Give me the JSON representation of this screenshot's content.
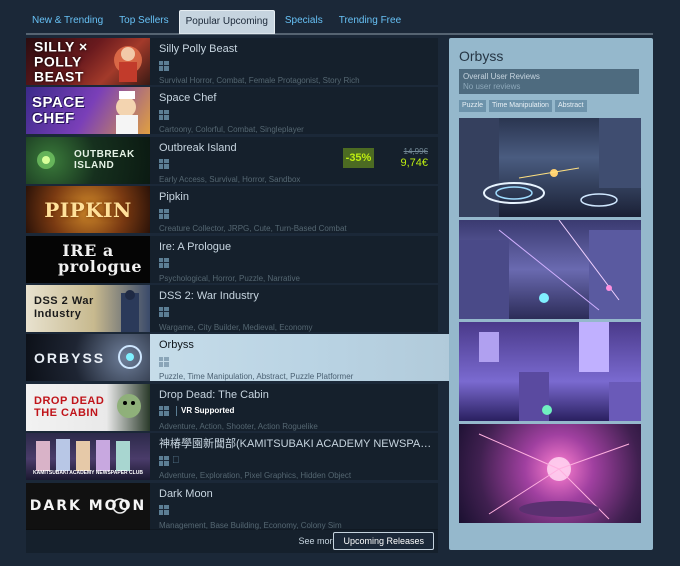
{
  "tabs": [
    {
      "label": "New & Trending",
      "active": false
    },
    {
      "label": "Top Sellers",
      "active": false
    },
    {
      "label": "Popular Upcoming",
      "active": true
    },
    {
      "label": "Specials",
      "active": false
    },
    {
      "label": "Trending Free",
      "active": false
    }
  ],
  "games": [
    {
      "name": "Silly Polly Beast",
      "tags": "Survival Horror, Combat, Female Protagonist, Story Rich",
      "capsule": "SILLY × POLLY BEAST"
    },
    {
      "name": "Space Chef",
      "tags": "Cartoony, Colorful, Combat, Singleplayer",
      "capsule": "SPACE CHEF"
    },
    {
      "name": "Outbreak Island",
      "tags": "Early Access, Survival, Horror, Sandbox",
      "capsule": "OUTBREAK ISLAND",
      "discount": "-35%",
      "original_price": "14,99€",
      "final_price": "9,74€"
    },
    {
      "name": "Pipkin",
      "tags": "Creature Collector, JRPG, Cute, Turn-Based Combat",
      "capsule": "PIPKIN"
    },
    {
      "name": "Ire: A Prologue",
      "tags": "Psychological, Horror, Puzzle, Narrative",
      "capsule": "IRE a prologue"
    },
    {
      "name": "DSS 2: War Industry",
      "tags": "Wargame, City Builder, Medieval, Economy",
      "capsule": "DSS 2 War Industry"
    },
    {
      "name": "Orbyss",
      "tags": "Puzzle, Time Manipulation, Abstract, Puzzle Platformer",
      "capsule": "ORBYSS"
    },
    {
      "name": "Drop Dead: The Cabin",
      "tags": "Adventure, Action, Shooter, Action Roguelike",
      "capsule": "DROP DEAD THE CABIN",
      "badge": "VR Supported"
    },
    {
      "name": "神椿學園新聞部(KAMITSUBAKI ACADEMY NEWSPAPER CLUB)",
      "tags": "Adventure, Exploration, Pixel Graphics, Hidden Object",
      "capsule": "KAMITSUBAKI ACADEMY NEWSPAPER CLUB"
    },
    {
      "name": "Dark Moon",
      "tags": "Management, Base Building, Economy, Colony Sim",
      "capsule": "DARK MOON"
    }
  ],
  "see_more": {
    "label": "See more:",
    "button": "Upcoming Releases"
  },
  "preview": {
    "title": "Orbyss",
    "review_label": "Overall User Reviews",
    "review_value": "No user reviews",
    "tags": [
      "Puzzle",
      "Time Manipulation",
      "Abstract"
    ]
  },
  "colors": {
    "background": "#1b2838",
    "link": "#67c1f5",
    "discount_bg": "#4c6b22",
    "discount_fg": "#beee11",
    "preview_bg": "#95b8cc"
  }
}
